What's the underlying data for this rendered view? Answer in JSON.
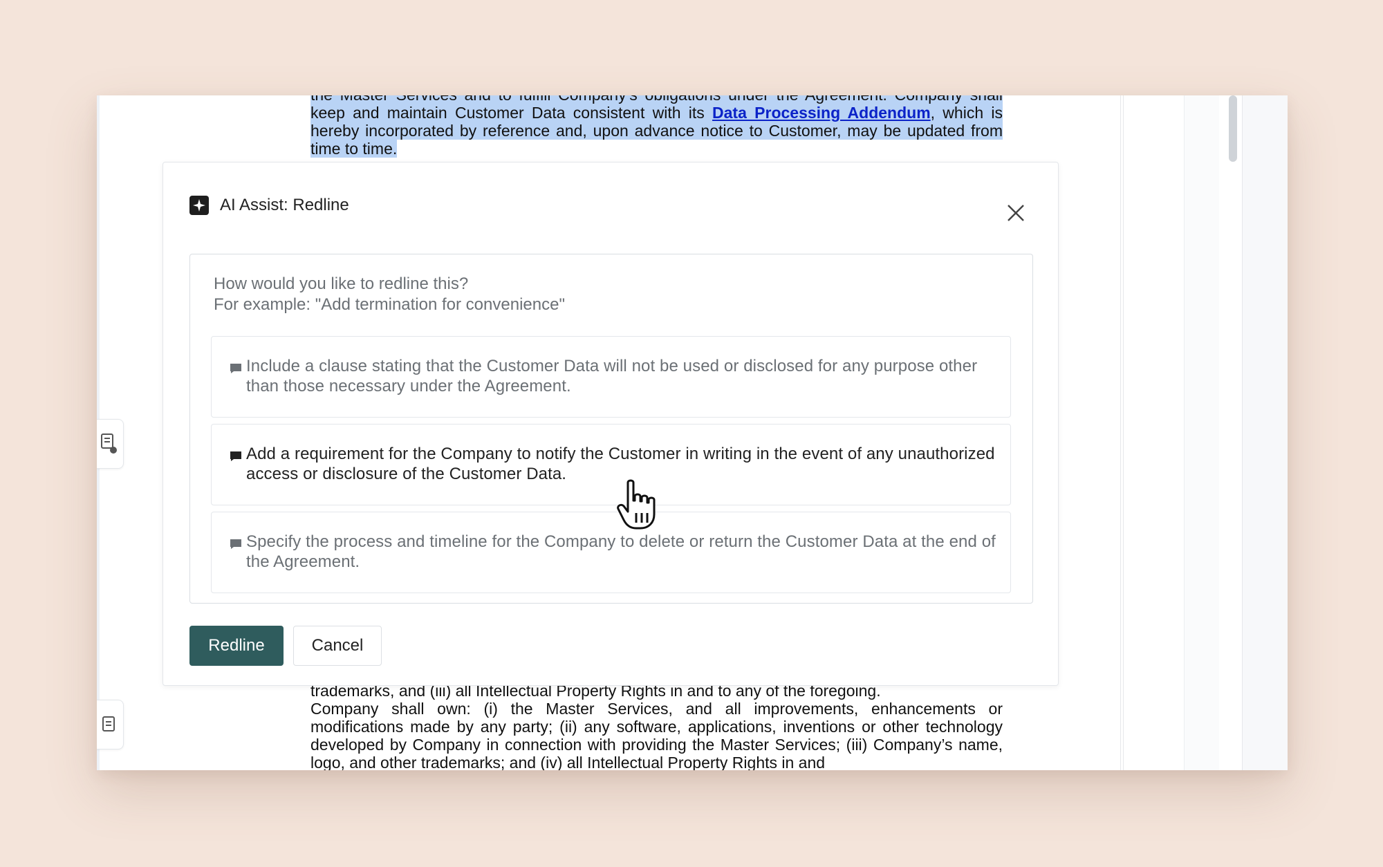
{
  "document": {
    "top_clip_text": "the Master Services and to fulfill Company’s obligations under the Agreement. Company shall",
    "para_before_link": "keep and maintain Customer Data consistent with its ",
    "link_text": "Data Processing Addendum",
    "para_after_link": ", which is hereby incorporated by reference and, upon advance notice to Customer, may be updated from time to time.",
    "bottom_line_1": "trademarks, and (iii) all Intellectual Property Rights in and to any of the foregoing.",
    "bottom_para": "Company shall own: (i) the Master Services, and all improvements, enhancements or modifications made by any party; (ii) any software, applications, inventions or other technology developed by Company in connection with providing the Master Services; (iii) Company’s name, logo, and other trademarks; and (iv) all Intellectual Property Rights in and"
  },
  "dialog": {
    "title": "AI Assist: Redline",
    "title_icon": "sparkle-icon",
    "close_icon": "close-icon",
    "placeholder_line_1": "How would you like to redline this?",
    "placeholder_line_2": "For example: \"Add termination for convenience\"",
    "suggestions": [
      {
        "text": "Include a clause stating that the Customer Data will not be used or disclosed for any purpose other than those necessary under the Agreement.",
        "icon": "comment-icon"
      },
      {
        "text": "Add a requirement for the Company to notify the Customer in writing in the event of any unauthorized access or disclosure of the Customer Data.",
        "icon": "comment-icon"
      },
      {
        "text": "Specify the process and timeline for the Company to delete or return the Customer Data at the end of the Agreement.",
        "icon": "comment-icon"
      }
    ],
    "primary_button": "Redline",
    "secondary_button": "Cancel"
  },
  "colors": {
    "primary_button": "#2f5c5d",
    "highlight": "#b9d3f5",
    "link": "#0b23c8",
    "background": "#f4e4da"
  },
  "cursor_icon": "hand-pointer-icon"
}
